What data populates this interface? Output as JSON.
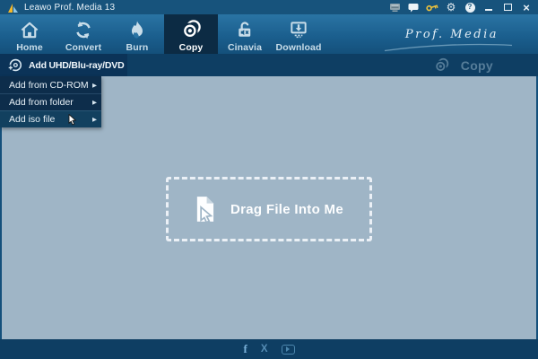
{
  "titlebar": {
    "title": "Leawo Prof. Media 13",
    "help_glyph": "?",
    "close_glyph": "×"
  },
  "nav": {
    "brand": "Prof. Media",
    "active_tab": "Copy",
    "tabs": [
      {
        "label": "Home"
      },
      {
        "label": "Convert"
      },
      {
        "label": "Burn"
      },
      {
        "label": "Copy"
      },
      {
        "label": "Cinavia"
      },
      {
        "label": "Download"
      }
    ]
  },
  "toolbar": {
    "add_button_label": "Add UHD/Blu-ray/DVD",
    "copy_button_label": "Copy"
  },
  "add_menu": {
    "items": [
      {
        "label": "Add from CD-ROM",
        "arrow": "▶"
      },
      {
        "label": "Add from folder",
        "arrow": "▶"
      },
      {
        "label": "Add iso file",
        "arrow": "▶"
      }
    ]
  },
  "main": {
    "dropzone_label": "Drag File Into Me"
  },
  "footer": {
    "facebook_glyph": "f",
    "x_glyph": "X"
  },
  "icons": {
    "titlebar": [
      "media-device-icon",
      "chat-icon",
      "key-icon",
      "gear-icon",
      "help-icon",
      "minimize-icon",
      "maximize-icon",
      "close-icon"
    ],
    "tabs": [
      "home-icon",
      "convert-icon",
      "burn-icon",
      "copy-disc-icon",
      "cinavia-lock-icon",
      "download-icon"
    ],
    "other": [
      "leawo-logo-icon",
      "add-disc-icon",
      "copy-disc-icon",
      "file-drag-icon",
      "facebook-icon",
      "x-icon",
      "youtube-icon",
      "mouse-cursor"
    ]
  },
  "colors": {
    "titlebar_bg": "#17537c",
    "nav_bg_top": "#2a74a4",
    "nav_bg_bottom": "#14507b",
    "active_tab_bg": "#0c2b44",
    "panel_bg": "#0e3e63",
    "add_button_bg": "#0b3358",
    "menu_bg": "#0d2d4b",
    "main_bg": "#9fb5c6",
    "key_gold": "#eec23c",
    "disabled_text": "#567d99",
    "icon_light": "#c9dde9"
  }
}
